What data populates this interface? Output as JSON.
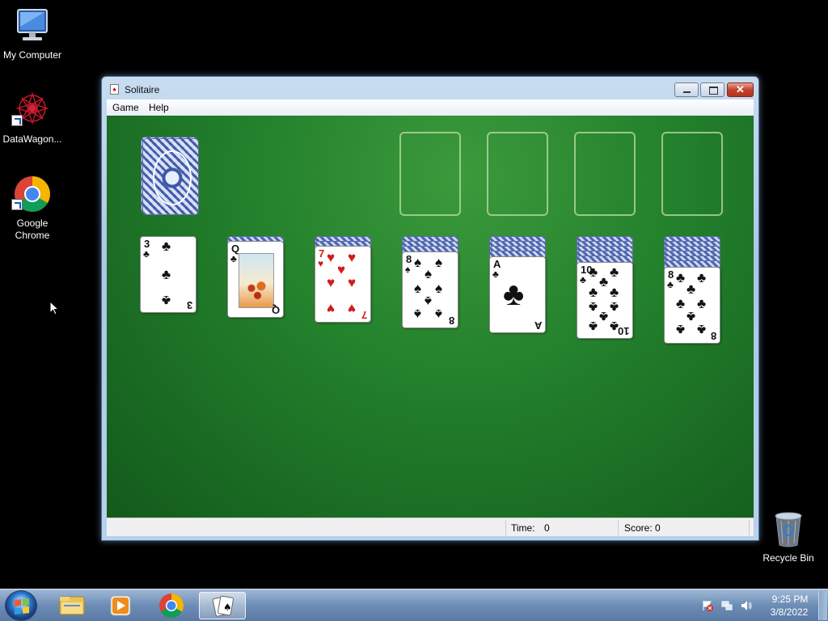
{
  "desktop": {
    "icons": [
      {
        "label": "My Computer",
        "icon": "computer-icon"
      },
      {
        "label": "DataWagon...",
        "icon": "datawagon-icon"
      },
      {
        "label": "Google Chrome",
        "icon": "chrome-icon"
      },
      {
        "label": "Recycle Bin",
        "icon": "recycle-bin-icon"
      }
    ]
  },
  "window": {
    "title": "Solitaire",
    "menu": [
      "Game",
      "Help"
    ],
    "status": {
      "time_label": "Time:",
      "time_value": "0",
      "score_label": "Score: 0"
    }
  },
  "game": {
    "stock": "face-down deck",
    "foundations": [
      "empty",
      "empty",
      "empty",
      "empty"
    ],
    "tableau": [
      {
        "face_down": 0,
        "top": {
          "rank": "3",
          "suit": "♣",
          "color": "black"
        }
      },
      {
        "face_down": 1,
        "top": {
          "rank": "Q",
          "suit": "♣",
          "color": "black"
        }
      },
      {
        "face_down": 2,
        "top": {
          "rank": "7",
          "suit": "♥",
          "color": "red"
        }
      },
      {
        "face_down": 3,
        "top": {
          "rank": "8",
          "suit": "♠",
          "color": "black"
        }
      },
      {
        "face_down": 4,
        "top": {
          "rank": "A",
          "suit": "♣",
          "color": "black"
        }
      },
      {
        "face_down": 5,
        "top": {
          "rank": "10",
          "suit": "♣",
          "color": "black"
        }
      },
      {
        "face_down": 6,
        "top": {
          "rank": "8",
          "suit": "♣",
          "color": "black"
        }
      }
    ]
  },
  "taskbar": {
    "items": [
      "explorer-icon",
      "media-player-icon",
      "chrome-icon",
      "solitaire-icon"
    ],
    "clock_time": "9:25 PM",
    "clock_date": "3/8/2022"
  },
  "colors": {
    "felt": "#227f2b",
    "taskbar": "#6d8db6",
    "desktop": "#000000"
  }
}
